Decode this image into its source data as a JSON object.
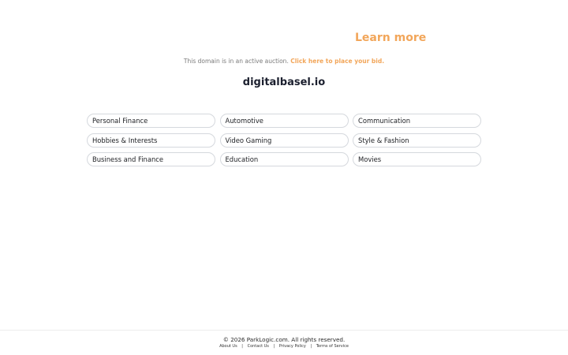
{
  "header": {
    "learn_more": "Learn more"
  },
  "auction": {
    "text": "This domain is in an active auction.",
    "link": "Click here to place your bid."
  },
  "domain": "digitalbasel.io",
  "categories": [
    "Personal Finance",
    "Automotive",
    "Communication",
    "Hobbies & Interests",
    "Video Gaming",
    "Style & Fashion",
    "Business and Finance",
    "Education",
    "Movies"
  ],
  "footer": {
    "copyright": "© 2026 ParkLogic.com. All rights reserved.",
    "links": [
      "About Us",
      "Contact Us",
      "Privacy Policy",
      "Terms of Service"
    ],
    "separator": "|"
  },
  "colors": {
    "accent": "#f2a65a",
    "title": "#1b1f2e",
    "pill_border": "#d5d8dd"
  }
}
